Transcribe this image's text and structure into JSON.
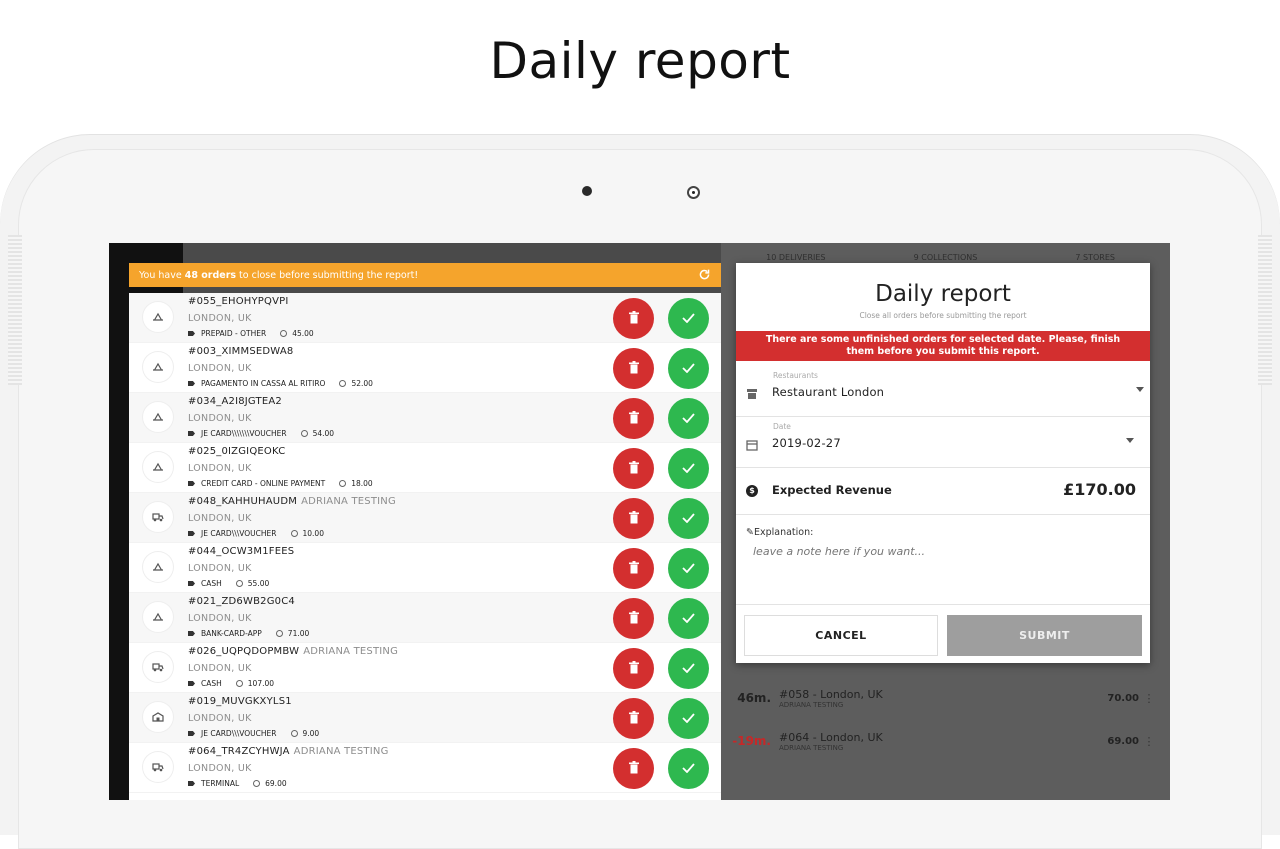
{
  "page_title": "Daily report",
  "alert": {
    "prefix": "You have",
    "count": "48 orders",
    "suffix": "to close before submitting the report!"
  },
  "background": {
    "tabs": [
      "10 DELIVERIES",
      "9 COLLECTIONS",
      "7 STORES"
    ],
    "rows": [
      {
        "mins": "46m.",
        "title": "#058 - London, UK",
        "sub": "ADRIANA TESTING",
        "value": "70.00"
      },
      {
        "mins": "-19m.",
        "title": "#064 - London, UK",
        "sub": "ADRIANA TESTING",
        "value": "69.00"
      }
    ]
  },
  "orders": [
    {
      "code": "#055_EHOHYPQVPI",
      "customer": "",
      "location": "LONDON, UK",
      "payment": "PREPAID - OTHER",
      "amount": "45.00",
      "icon": "takeaway-icon"
    },
    {
      "code": "#003_XIMMSEDWA8",
      "customer": "",
      "location": "LONDON, UK",
      "payment": "PAGAMENTO IN CASSA AL RITIRO",
      "amount": "52.00",
      "icon": "takeaway-icon"
    },
    {
      "code": "#034_A2I8JGTEA2",
      "customer": "",
      "location": "LONDON, UK",
      "payment": "JE CARD\\\\\\\\\\\\\\VOUCHER",
      "amount": "54.00",
      "icon": "takeaway-icon"
    },
    {
      "code": "#025_0IZGIQEOKC",
      "customer": "",
      "location": "LONDON, UK",
      "payment": "CREDIT CARD - ONLINE PAYMENT",
      "amount": "18.00",
      "icon": "takeaway-icon"
    },
    {
      "code": "#048_KAHHUHAUDM",
      "customer": "ADRIANA TESTING",
      "location": "LONDON, UK",
      "payment": "JE CARD\\\\\\VOUCHER",
      "amount": "10.00",
      "icon": "delivery-icon"
    },
    {
      "code": "#044_OCW3M1FEES",
      "customer": "",
      "location": "LONDON, UK",
      "payment": "CASH",
      "amount": "55.00",
      "icon": "takeaway-icon"
    },
    {
      "code": "#021_ZD6WB2G0C4",
      "customer": "",
      "location": "LONDON, UK",
      "payment": "BANK-CARD-APP",
      "amount": "71.00",
      "icon": "takeaway-icon"
    },
    {
      "code": "#026_UQPQDOPMBW",
      "customer": "ADRIANA TESTING",
      "location": "LONDON, UK",
      "payment": "CASH",
      "amount": "107.00",
      "icon": "delivery-icon"
    },
    {
      "code": "#019_MUVGKXYLS1",
      "customer": "",
      "location": "LONDON, UK",
      "payment": "JE CARD\\\\\\VOUCHER",
      "amount": "9.00",
      "icon": "store-icon"
    },
    {
      "code": "#064_TR4ZCYHWJA",
      "customer": "ADRIANA TESTING",
      "location": "LONDON, UK",
      "payment": "TERMINAL",
      "amount": "69.00",
      "icon": "delivery-icon"
    }
  ],
  "dialog": {
    "title": "Daily report",
    "subtitle": "Close all orders before submitting the report",
    "warning": "There are some unfinished orders for selected date. Please, finish them before you submit this report.",
    "restaurant_label": "Restaurants",
    "restaurant_value": "Restaurant London",
    "date_label": "Date",
    "date_value": "2019-02-27",
    "revenue_label": "Expected Revenue",
    "revenue_value": "£170.00",
    "explanation_label": "Explanation:",
    "explanation_placeholder": "leave a note here if you want...",
    "cancel_label": "CANCEL",
    "submit_label": "SUBMIT"
  },
  "colors": {
    "alert": "#f5a42c",
    "delete": "#d32f2f",
    "confirm": "#2eb84f",
    "warning": "#d32f2f",
    "submit_disabled": "#9e9e9e"
  }
}
